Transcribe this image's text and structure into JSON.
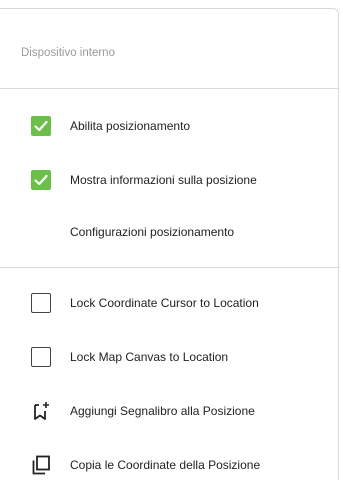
{
  "header": {
    "title": "Dispositivo interno"
  },
  "accent_color": "#6cc04a",
  "items": [
    {
      "label": "Abilita posizionamento",
      "checked": true
    },
    {
      "label": "Mostra informazioni sulla posizione",
      "checked": true
    },
    {
      "label": "Configurazioni posizionamento"
    },
    {
      "label": "Lock Coordinate Cursor to Location",
      "checked": false
    },
    {
      "label": "Lock Map Canvas to Location",
      "checked": false
    },
    {
      "label": "Aggiungi Segnalibro alla Posizione",
      "icon": "bookmark-add-icon"
    },
    {
      "label": "Copia le Coordinate della Posizione",
      "icon": "copy-icon"
    }
  ]
}
